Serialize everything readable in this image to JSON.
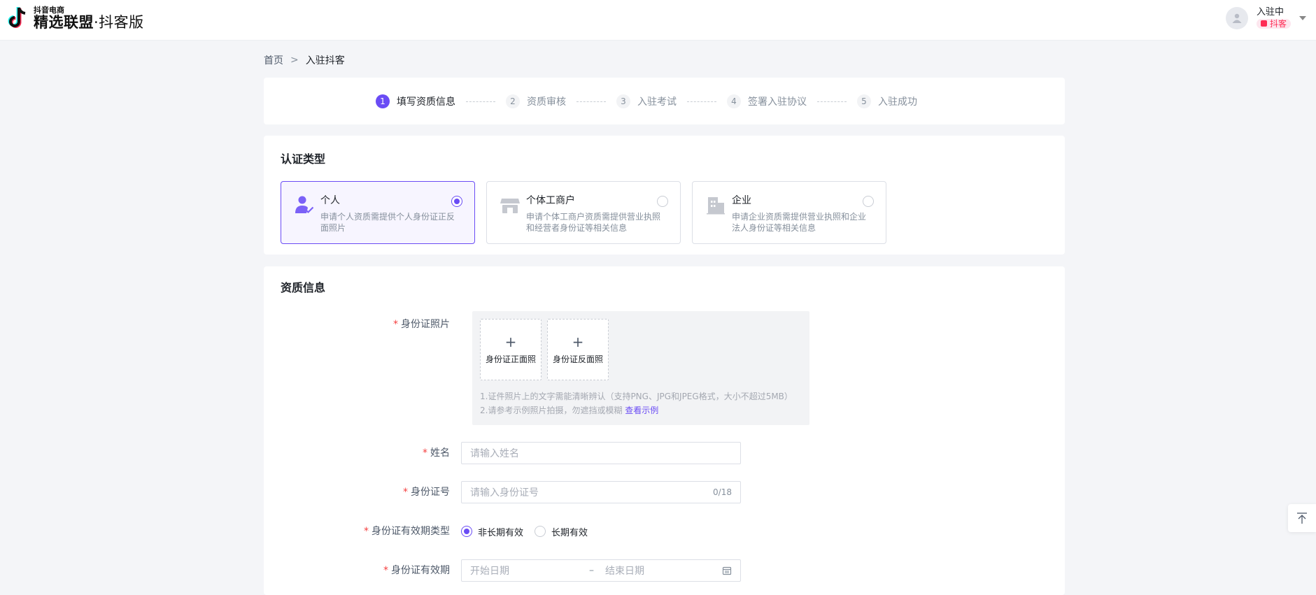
{
  "header": {
    "brand_small": "抖音电商",
    "brand_main": "精选联盟",
    "brand_sub": "·抖客版",
    "user_status": "入驻中",
    "user_tag": "抖客",
    "brand_color": "#fe2c55"
  },
  "breadcrumb": {
    "home": "首页",
    "separator": ">",
    "current": "入驻抖客"
  },
  "steps": [
    {
      "num": "1",
      "label": "填写资质信息",
      "active": true
    },
    {
      "num": "2",
      "label": "资质审核",
      "active": false
    },
    {
      "num": "3",
      "label": "入驻考试",
      "active": false
    },
    {
      "num": "4",
      "label": "签署入驻协议",
      "active": false
    },
    {
      "num": "5",
      "label": "入驻成功",
      "active": false
    }
  ],
  "auth_type": {
    "title": "认证类型",
    "options": [
      {
        "title": "个人",
        "desc": "申请个人资质需提供个人身份证正反面照片",
        "selected": true,
        "icon": "person-check-icon"
      },
      {
        "title": "个体工商户",
        "desc": "申请个体工商户资质需提供营业执照和经营者身份证等相关信息",
        "selected": false,
        "icon": "shop-icon"
      },
      {
        "title": "企业",
        "desc": "申请企业资质需提供营业执照和企业法人身份证等相关信息",
        "selected": false,
        "icon": "building-icon"
      }
    ]
  },
  "qualification": {
    "title": "资质信息",
    "id_photo_label": "身份证照片",
    "upload_front": "身份证正面照",
    "upload_back": "身份证反面照",
    "upload_plus": "+",
    "hint1": "1.证件照片上的文字需能清晰辨认（支持PNG、JPG和JPEG格式，大小不超过5MB）",
    "hint2": "2.请参考示例照片拍摄，勿遮挡或模糊",
    "hint2_link": "查看示例",
    "name_label": "姓名",
    "name_placeholder": "请输入姓名",
    "idno_label": "身份证号",
    "idno_placeholder": "请输入身份证号",
    "idno_counter": "0/18",
    "validity_type_label": "身份证有效期类型",
    "validity_options": [
      {
        "label": "非长期有效",
        "checked": true
      },
      {
        "label": "长期有效",
        "checked": false
      }
    ],
    "validity_label": "身份证有效期",
    "start_placeholder": "开始日期",
    "range_sep": "–",
    "end_placeholder": "结束日期",
    "required_mark": "*"
  },
  "accent_color": "#6a4cf5"
}
